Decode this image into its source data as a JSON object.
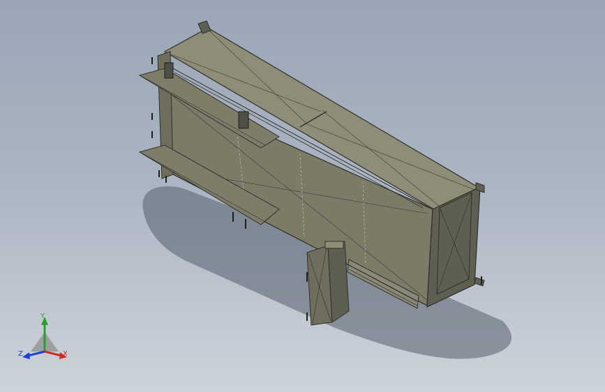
{
  "viewport": {
    "background_top": "#9aa6b6",
    "background_bottom": "#cdd3da"
  },
  "model": {
    "body_color": "#84836f",
    "top_color": "#8f8d78",
    "front_color": "#6f6e5d",
    "end_color": "#5e5e52",
    "edge_color": "#2f2f2a",
    "shadow_color": "#56616d"
  },
  "triad": {
    "x_label": "X",
    "y_label": "Y",
    "z_label": "Z",
    "x_color": "#d22b1f",
    "y_color": "#2aa02a",
    "z_color": "#1e3fd0"
  }
}
